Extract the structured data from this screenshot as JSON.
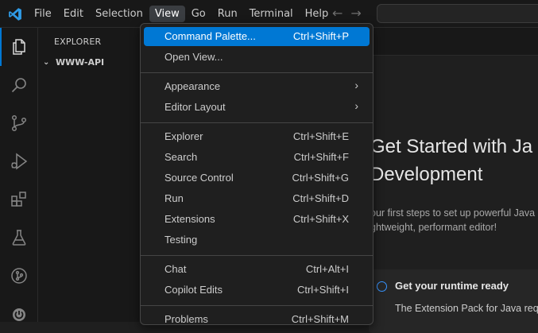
{
  "menubar": {
    "items": [
      "File",
      "Edit",
      "Selection",
      "View",
      "Go",
      "Run",
      "Terminal",
      "Help"
    ],
    "active_index": 3
  },
  "sidebar": {
    "title": "EXPLORER",
    "folder": "WWW-API"
  },
  "walkthrough": {
    "title_line1": "Get Started with Ja",
    "title_line2": "Development",
    "sub_line1": "our first steps to set up powerful Java",
    "sub_line2": "ghtweight, performant editor!",
    "card_title": "Get your runtime ready",
    "card_desc": "The Extension Pack for Java requ"
  },
  "view_menu": {
    "groups": [
      [
        {
          "label": "Command Palette...",
          "shortcut": "Ctrl+Shift+P"
        },
        {
          "label": "Open View...",
          "shortcut": ""
        }
      ],
      [
        {
          "label": "Appearance",
          "submenu": true
        },
        {
          "label": "Editor Layout",
          "submenu": true
        }
      ],
      [
        {
          "label": "Explorer",
          "shortcut": "Ctrl+Shift+E"
        },
        {
          "label": "Search",
          "shortcut": "Ctrl+Shift+F"
        },
        {
          "label": "Source Control",
          "shortcut": "Ctrl+Shift+G"
        },
        {
          "label": "Run",
          "shortcut": "Ctrl+Shift+D"
        },
        {
          "label": "Extensions",
          "shortcut": "Ctrl+Shift+X"
        },
        {
          "label": "Testing",
          "shortcut": ""
        }
      ],
      [
        {
          "label": "Chat",
          "shortcut": "Ctrl+Alt+I"
        },
        {
          "label": "Copilot Edits",
          "shortcut": "Ctrl+Shift+I"
        }
      ],
      [
        {
          "label": "Problems",
          "shortcut": "Ctrl+Shift+M"
        }
      ]
    ]
  },
  "colors": {
    "accent": "#0078d4",
    "menu_bg": "#1f1f1f",
    "activity_bg": "#181818"
  }
}
